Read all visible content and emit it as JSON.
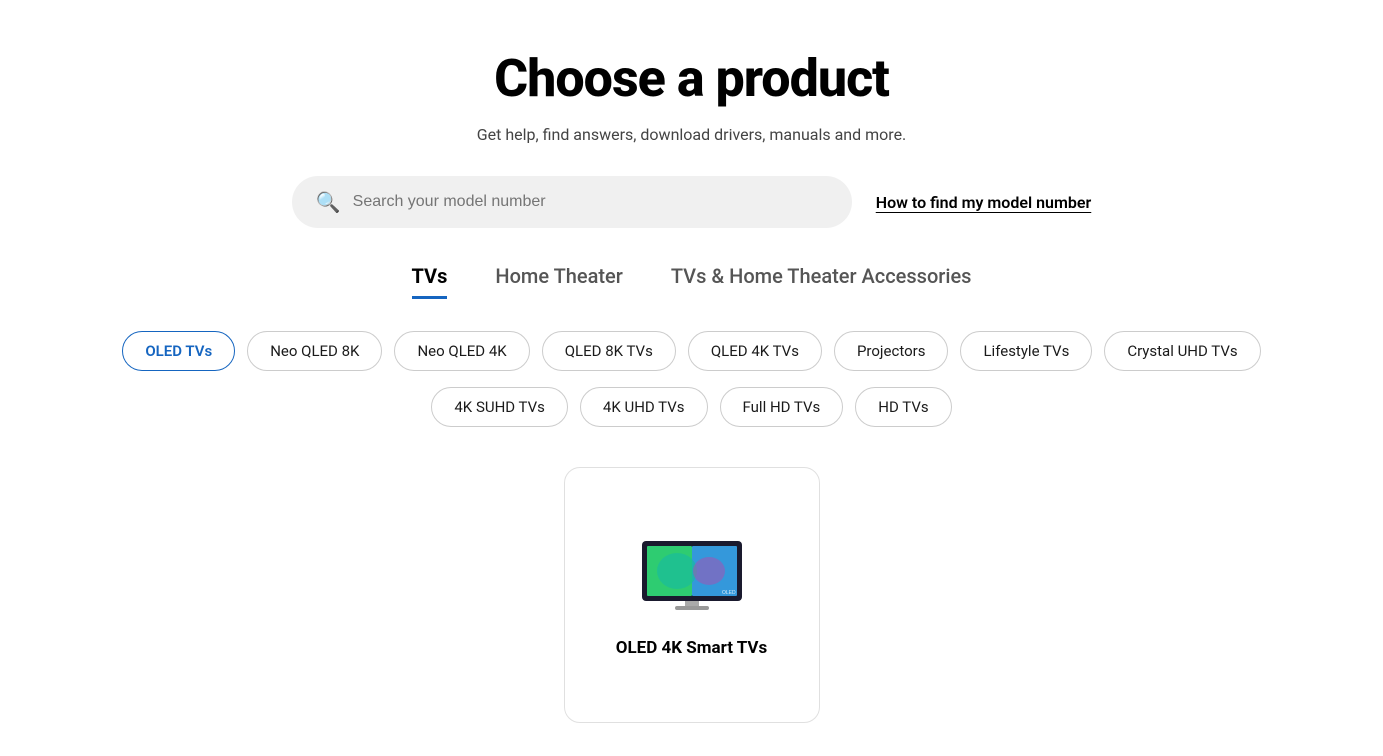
{
  "page": {
    "title": "Choose a product",
    "subtitle": "Get help, find answers, download drivers, manuals and more."
  },
  "search": {
    "placeholder": "Search your model number",
    "help_link": "How to find my model number"
  },
  "tabs": [
    {
      "label": "TVs",
      "active": true
    },
    {
      "label": "Home Theater",
      "active": false
    },
    {
      "label": "TVs & Home Theater Accessories",
      "active": false
    }
  ],
  "pills_row1": [
    {
      "label": "OLED TVs",
      "active": true
    },
    {
      "label": "Neo QLED 8K",
      "active": false
    },
    {
      "label": "Neo QLED 4K",
      "active": false
    },
    {
      "label": "QLED 8K TVs",
      "active": false
    },
    {
      "label": "QLED 4K TVs",
      "active": false
    },
    {
      "label": "Projectors",
      "active": false
    },
    {
      "label": "Lifestyle TVs",
      "active": false
    },
    {
      "label": "Crystal UHD TVs",
      "active": false
    }
  ],
  "pills_row2": [
    {
      "label": "4K SUHD TVs",
      "active": false
    },
    {
      "label": "4K UHD TVs",
      "active": false
    },
    {
      "label": "Full HD TVs",
      "active": false
    },
    {
      "label": "HD TVs",
      "active": false
    }
  ],
  "product_card": {
    "label": "OLED 4K Smart TVs"
  }
}
